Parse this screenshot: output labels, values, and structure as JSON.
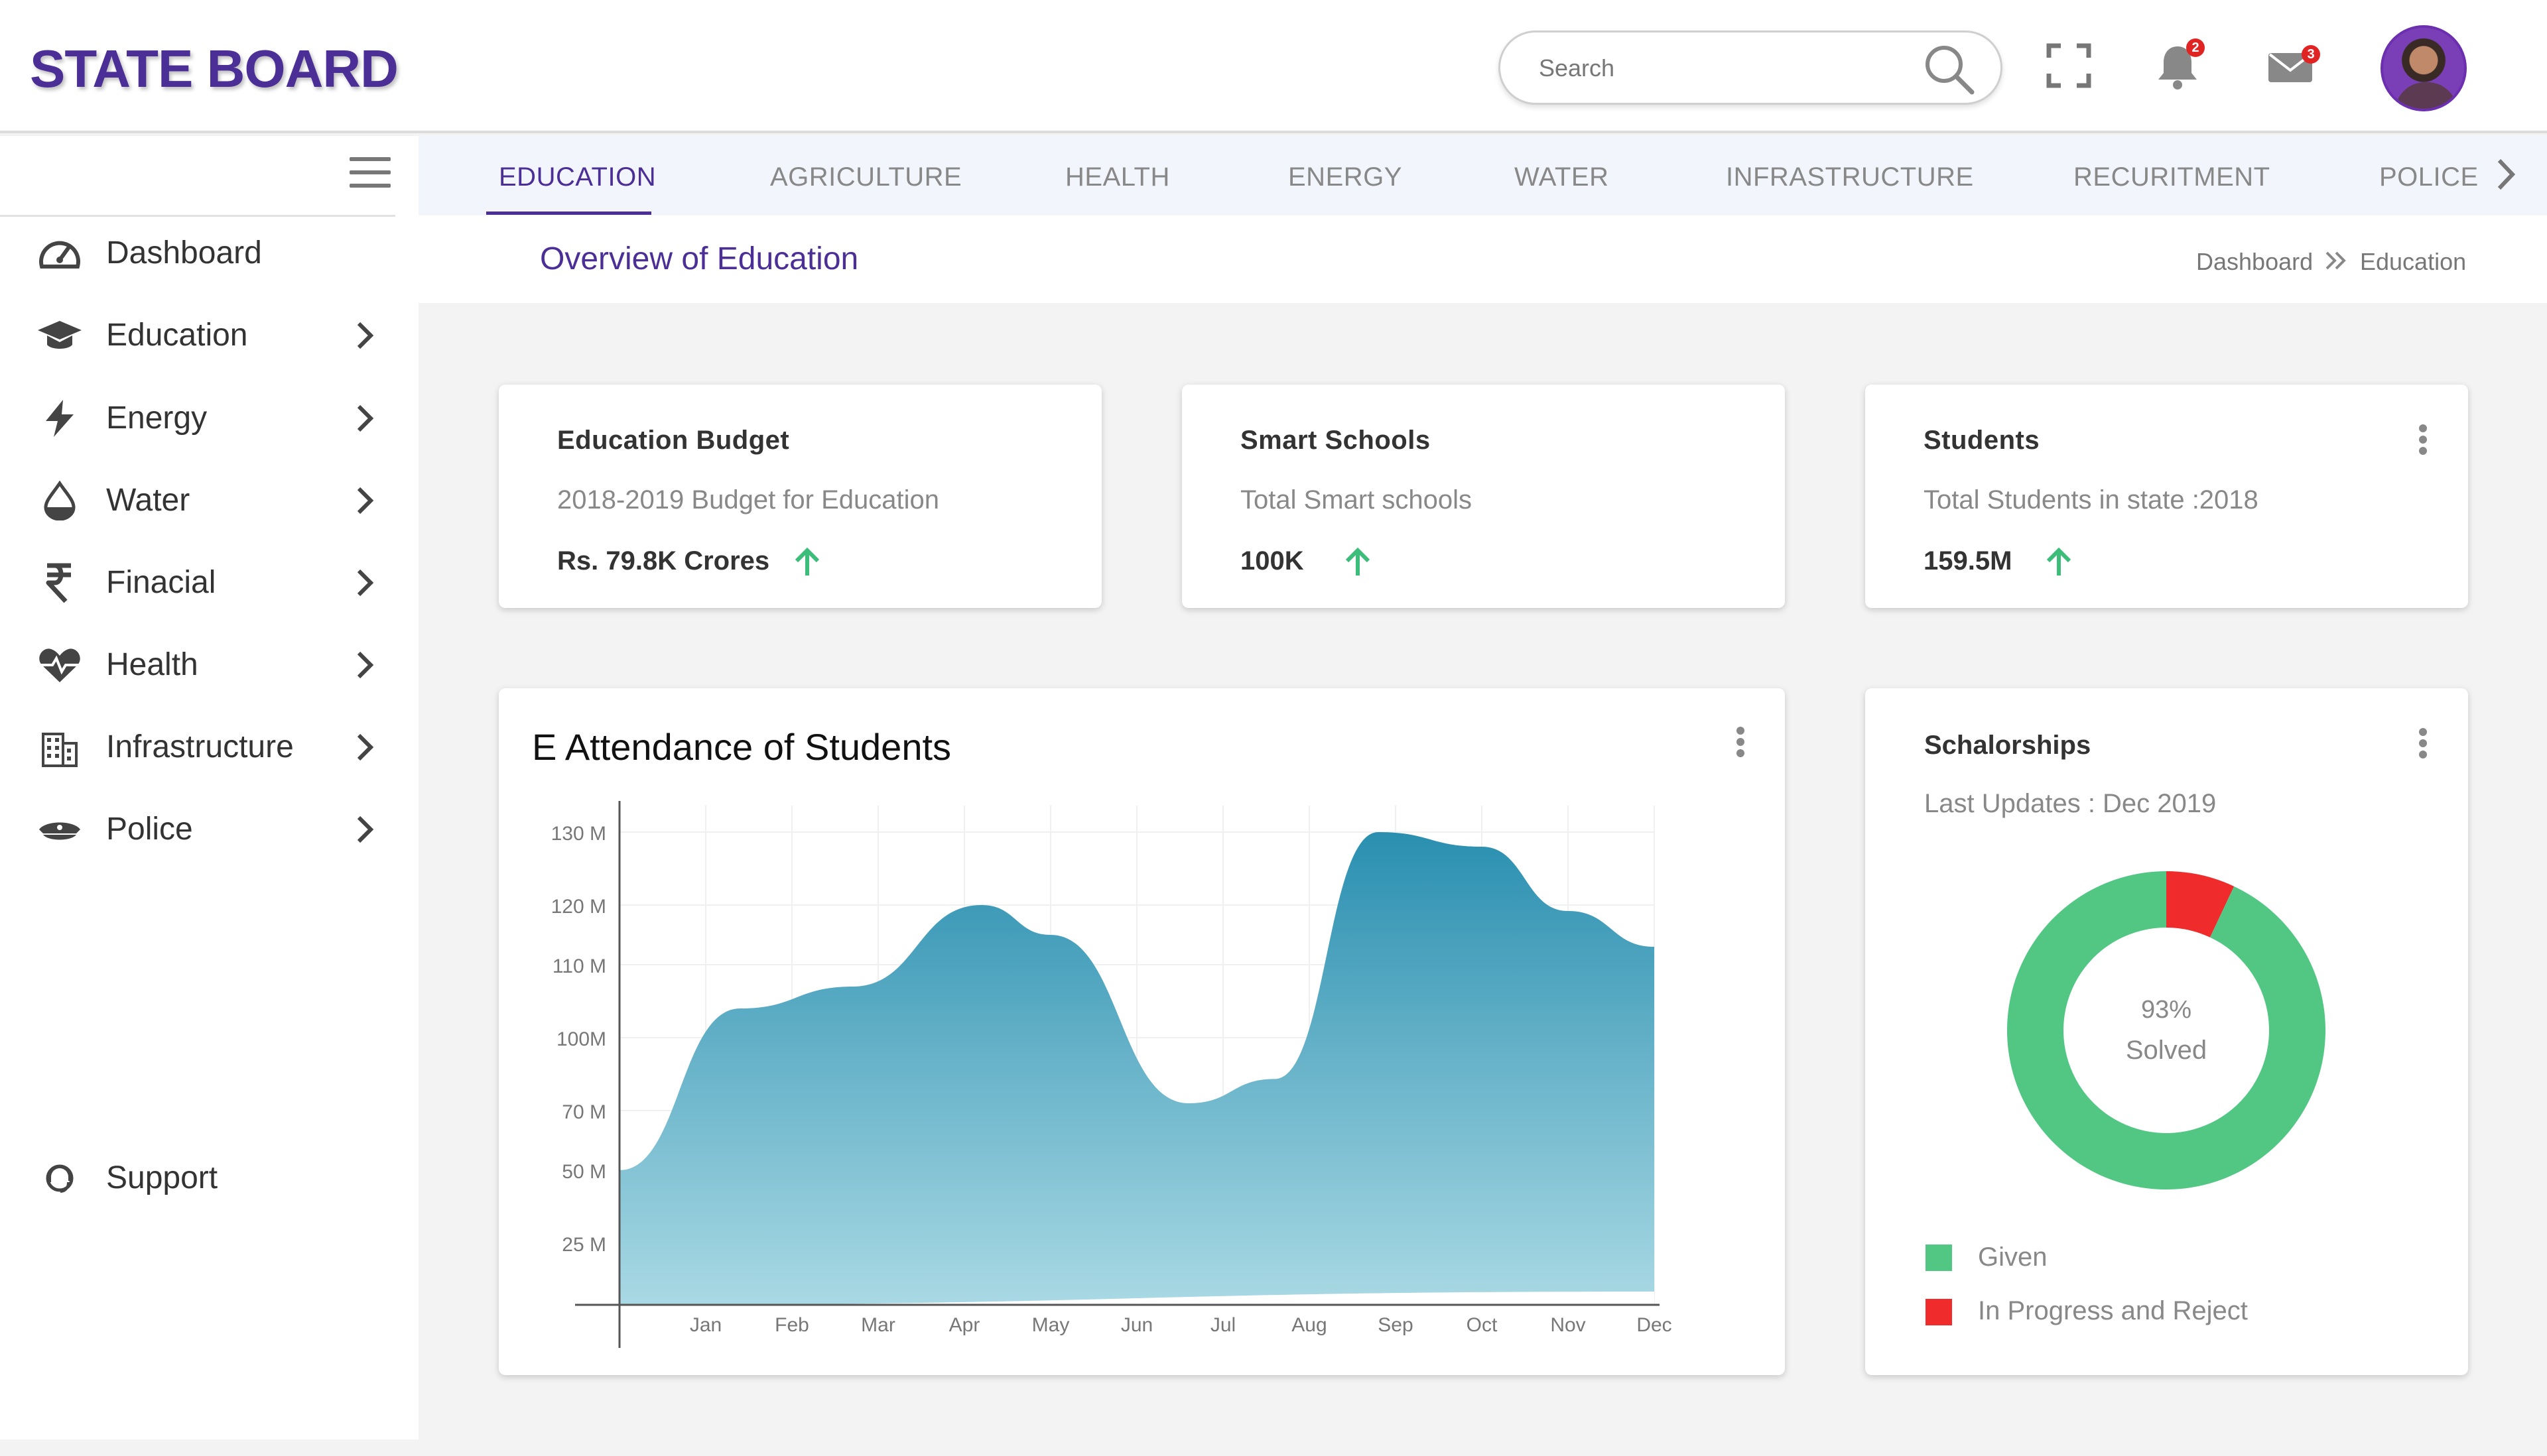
{
  "app": {
    "title": "STATE BOARD"
  },
  "search": {
    "placeholder": "Search"
  },
  "header": {
    "notifications_count": "2",
    "messages_count": "3"
  },
  "sidebar": {
    "items": [
      {
        "label": "Dashboard",
        "icon": "speedometer-icon"
      },
      {
        "label": "Education",
        "icon": "graduation-cap-icon"
      },
      {
        "label": "Energy",
        "icon": "lightning-icon"
      },
      {
        "label": "Water",
        "icon": "water-drop-icon"
      },
      {
        "label": "Finacial",
        "icon": "rupee-icon"
      },
      {
        "label": "Health",
        "icon": "heartbeat-icon"
      },
      {
        "label": "Infrastructure",
        "icon": "building-icon"
      },
      {
        "label": "Police",
        "icon": "police-cap-icon"
      }
    ],
    "support": {
      "label": "Support",
      "icon": "support-agent-icon"
    }
  },
  "tabs": [
    {
      "label": "EDUCATION",
      "active": true
    },
    {
      "label": "AGRICULTURE",
      "active": false
    },
    {
      "label": "HEALTH",
      "active": false
    },
    {
      "label": "ENERGY",
      "active": false
    },
    {
      "label": "WATER",
      "active": false
    },
    {
      "label": "INFRASTRUCTURE",
      "active": false
    },
    {
      "label": "RECURITMENT",
      "active": false
    },
    {
      "label": "POLICE",
      "active": false
    }
  ],
  "page": {
    "title": "Overview of Education"
  },
  "breadcrumb": {
    "items": [
      "Dashboard",
      "Education"
    ]
  },
  "stats": [
    {
      "title": "Education Budget",
      "subtitle": "2018-2019 Budget for Education",
      "value": "Rs. 79.8K Crores",
      "trend": "up"
    },
    {
      "title": "Smart Schools",
      "subtitle": "Total Smart schools",
      "value": "100K",
      "trend": "up"
    },
    {
      "title": "Students",
      "subtitle": "Total Students in state :2018",
      "value": "159.5M",
      "trend": "up"
    }
  ],
  "attendance": {
    "title": "E Attendance of Students"
  },
  "scholarships": {
    "title": "Schalorships",
    "subtitle": "Last Updates : Dec 2019",
    "center_value": "93%",
    "center_label": "Solved",
    "legend": [
      {
        "label": "Given",
        "color": "#52c783"
      },
      {
        "label": "In Progress and Reject",
        "color": "#ef2b2b"
      }
    ]
  },
  "colors": {
    "brand": "#4b2f96",
    "trend_up": "#3cbd7a",
    "area_top": "#2a8fb0",
    "area_bottom": "#a9d9e4"
  },
  "chart_data": [
    {
      "type": "area",
      "title": "E Attendance of Students",
      "categories": [
        "Jan",
        "Feb",
        "Mar",
        "Apr",
        "May",
        "Jun",
        "Jul",
        "Aug",
        "Sep",
        "Oct",
        "Nov",
        "Dec"
      ],
      "y_tick_labels": [
        "25 M",
        "50 M",
        "70 M",
        "100M",
        "110 M",
        "120 M",
        "130 M"
      ],
      "y_tick_values": [
        25,
        50,
        70,
        100,
        110,
        120,
        130
      ],
      "values": [
        104,
        107,
        120,
        115,
        73,
        83,
        130,
        128,
        119,
        113
      ],
      "x_positions": [
        1.4,
        2.7,
        4.2,
        5.0,
        6.6,
        7.6,
        8.8,
        10.0,
        11.0,
        12.0
      ],
      "start_value": 50,
      "baseline_start": 0,
      "baseline_end": 5,
      "grid": true,
      "legend": "none"
    },
    {
      "type": "pie",
      "title": "Schalorships",
      "labels": [
        "Given",
        "In Progress and Reject"
      ],
      "values": [
        93,
        7
      ],
      "colors": [
        "#52c783",
        "#ef2b2b"
      ],
      "donut": true
    }
  ]
}
